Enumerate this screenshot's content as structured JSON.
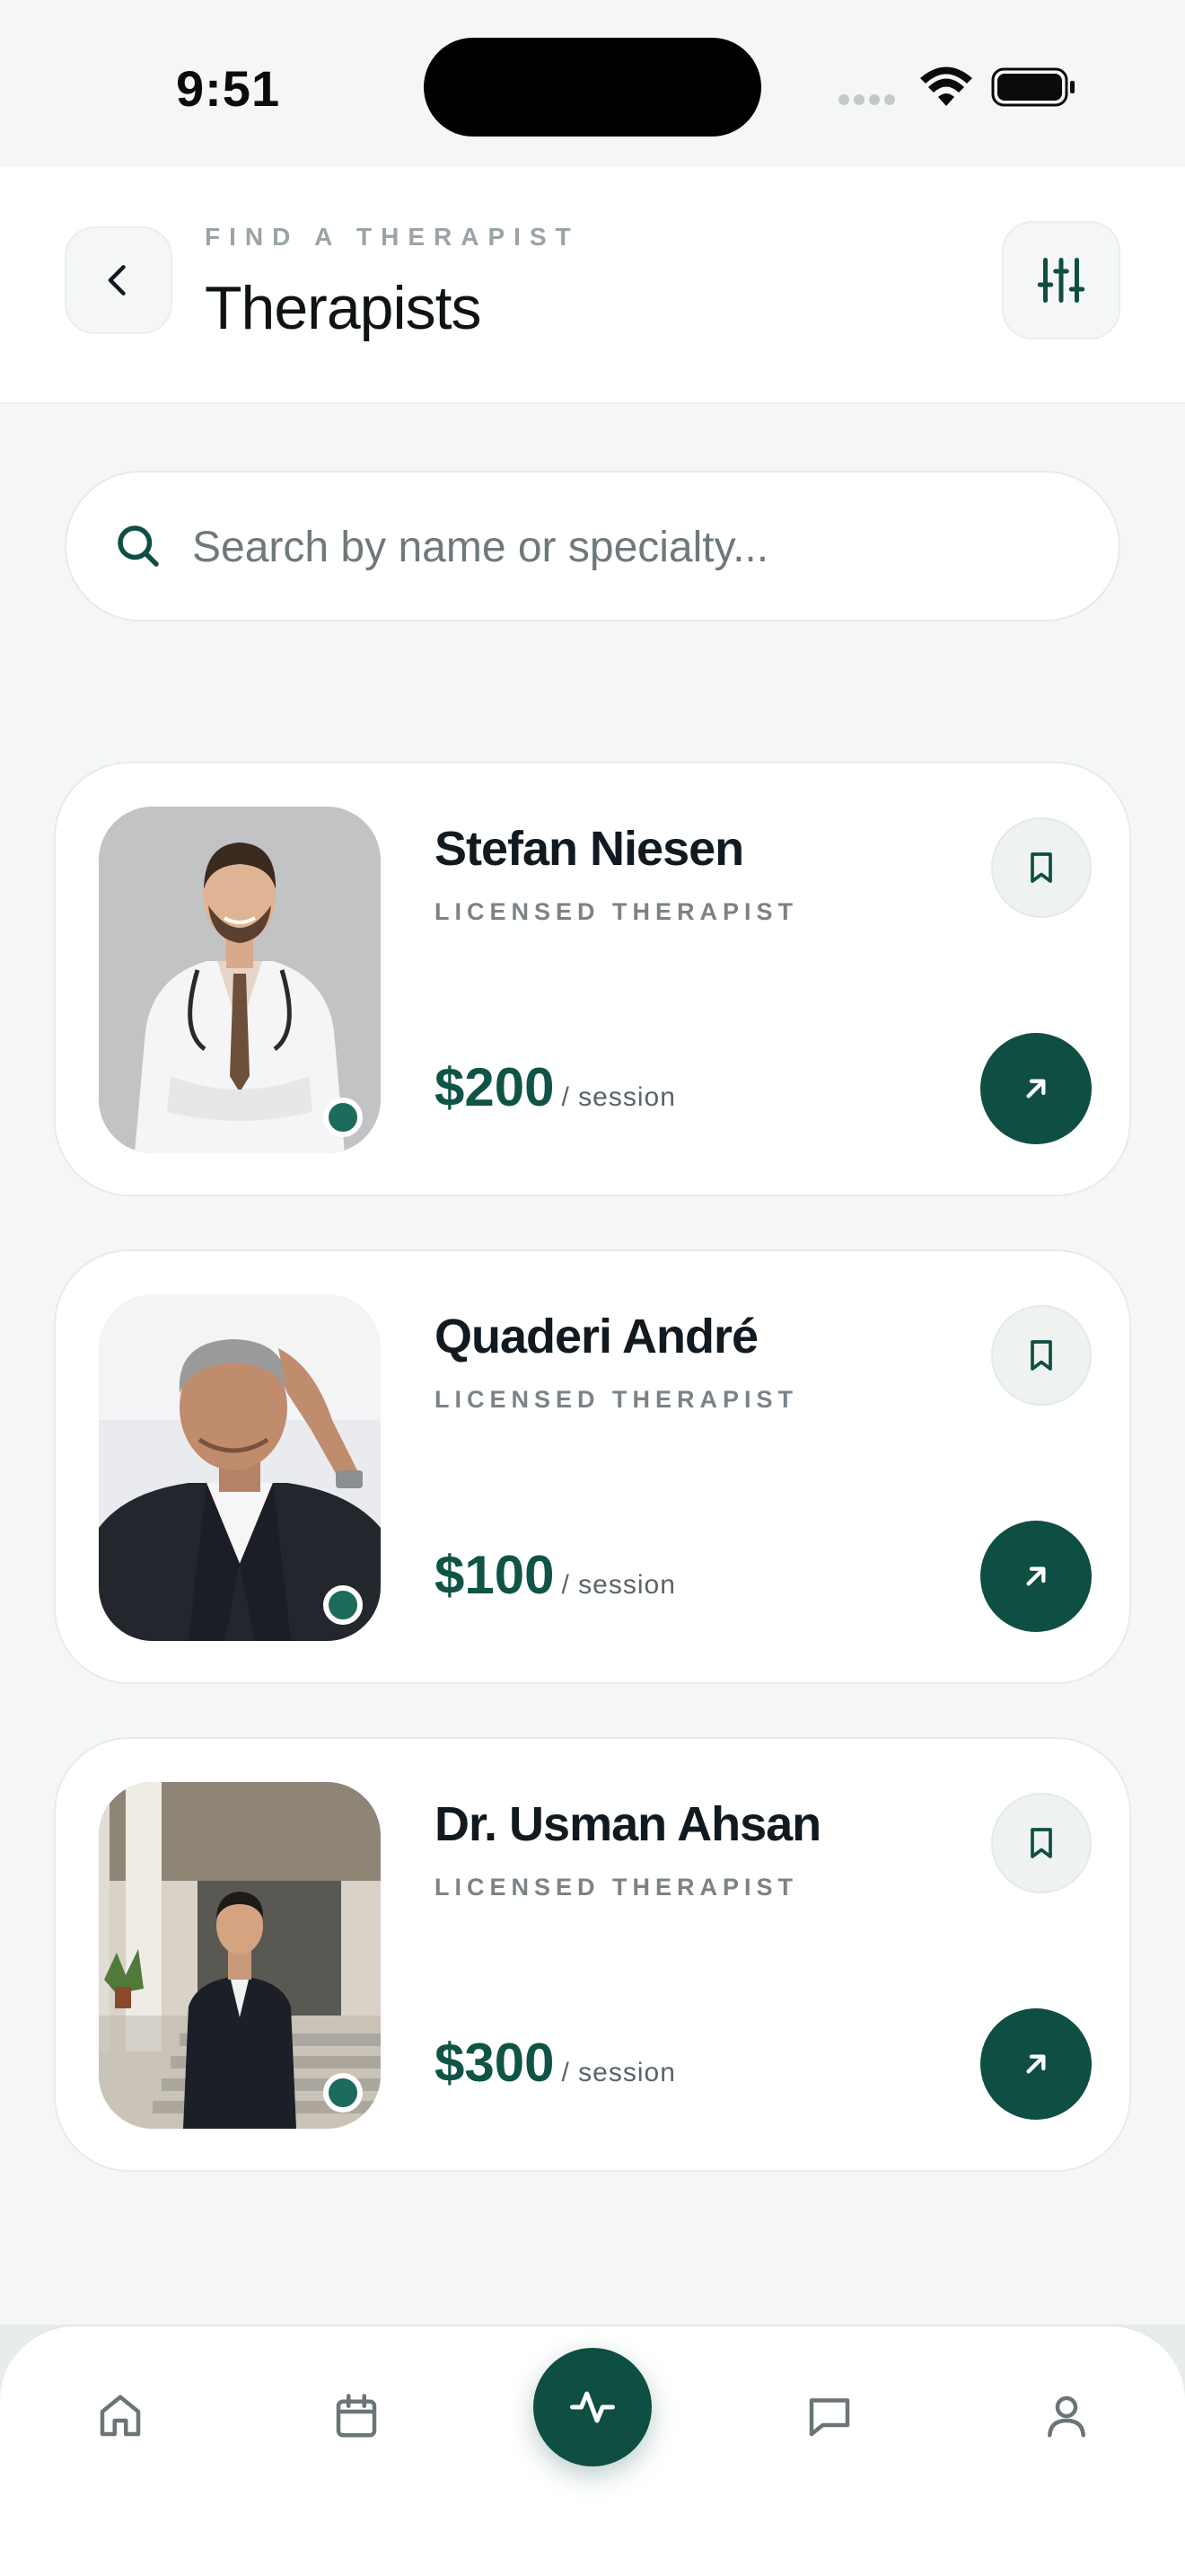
{
  "status_bar": {
    "time": "9:51"
  },
  "header": {
    "eyebrow": "FIND A THERAPIST",
    "title": "Therapists",
    "back_icon": "chevron-left-icon",
    "filter_icon": "sliders-icon"
  },
  "search": {
    "placeholder": "Search by name or specialty..."
  },
  "therapists": [
    {
      "name": "Stefan Niesen",
      "role": "LICENSED THERAPIST",
      "price": "$200",
      "per": "/ session",
      "online": true
    },
    {
      "name": "Quaderi André",
      "role": "LICENSED THERAPIST",
      "price": "$100",
      "per": "/ session",
      "online": true
    },
    {
      "name": "Dr. Usman Ahsan",
      "role": "LICENSED THERAPIST",
      "price": "$300",
      "per": "/ session",
      "online": true
    }
  ],
  "nav": {
    "items": [
      "home-icon",
      "calendar-icon",
      "activity-icon",
      "chat-icon",
      "profile-icon"
    ],
    "active": "activity-icon"
  },
  "colors": {
    "accent": "#0f4e42",
    "price": "#0f5446",
    "background": "#f4f7f6"
  }
}
